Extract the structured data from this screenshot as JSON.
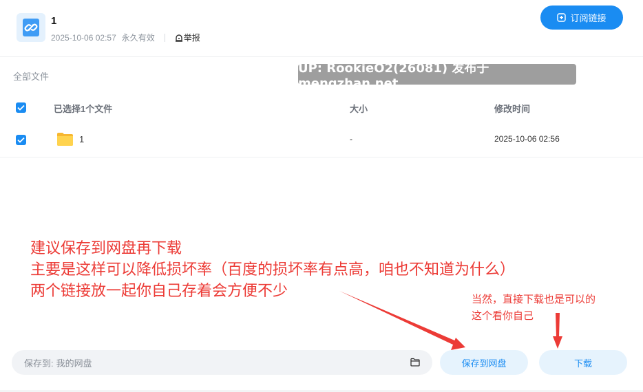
{
  "header": {
    "title": "1",
    "date": "2025-10-06 02:57",
    "validity": "永久有效",
    "report_label": "举报",
    "subscribe_label": "订阅链接"
  },
  "breadcrumb": {
    "label": "全部文件"
  },
  "watermark": {
    "text": "UP: RookieO2(26081) 发布于 mengzhan.net"
  },
  "table": {
    "header": {
      "selected_label": "已选择1个文件",
      "size_label": "大小",
      "modified_label": "修改时间"
    },
    "rows": [
      {
        "name": "1",
        "size": "-",
        "modified": "2025-10-06 02:56"
      }
    ]
  },
  "annotations": {
    "line1": "建议保存到网盘再下载",
    "line2": "主要是这样可以降低损坏率（百度的损坏率有点高，咱也不知道为什么）",
    "line3": "两个链接放一起你自己存着会方便不少",
    "side_line1": "当然，直接下载也是可以的",
    "side_line2": "这个看你自己"
  },
  "bottom": {
    "save_to_label": "保存到:",
    "save_to_value": "我的网盘",
    "save_button": "保存到网盘",
    "download_button": "下载"
  },
  "colors": {
    "accent": "#1a8cf2",
    "annotation": "#ec3b36",
    "button_bg": "#e6f3fd"
  }
}
